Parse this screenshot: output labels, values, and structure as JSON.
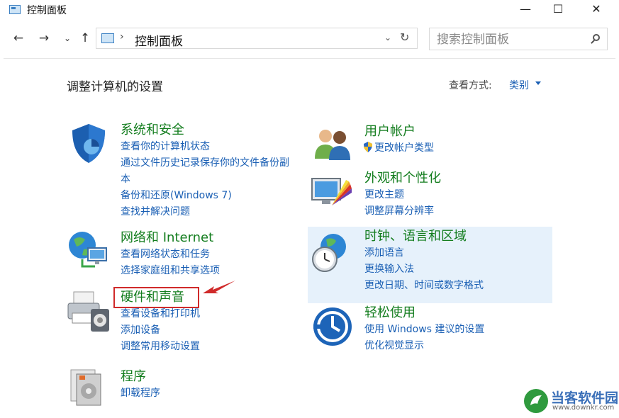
{
  "window": {
    "title": "控制面板",
    "minimize": "—",
    "maximize": "☐",
    "close": "✕"
  },
  "nav": {
    "back": "←",
    "forward": "→",
    "recent": "⌄",
    "up": "↑"
  },
  "address": {
    "separator": "›",
    "path": "控制面板",
    "dropdown": "⌄",
    "refresh": "↻"
  },
  "search": {
    "placeholder": "搜索控制面板"
  },
  "main": {
    "heading": "调整计算机的设置",
    "view_label": "查看方式:",
    "view_value": "类别"
  },
  "categories": {
    "system": {
      "title": "系统和安全",
      "links": [
        "查看你的计算机状态",
        "通过文件历史记录保存你的文件备份副",
        "本",
        "备份和还原(Windows 7)",
        "查找并解决问题"
      ]
    },
    "network": {
      "title": "网络和 Internet",
      "links": [
        "查看网络状态和任务",
        "选择家庭组和共享选项"
      ]
    },
    "hardware": {
      "title": "硬件和声音",
      "links": [
        "查看设备和打印机",
        "添加设备",
        "调整常用移动设置"
      ]
    },
    "programs": {
      "title": "程序",
      "links": [
        "卸载程序"
      ]
    },
    "users": {
      "title": "用户帐户",
      "links": [
        "更改帐户类型"
      ]
    },
    "appearance": {
      "title": "外观和个性化",
      "links": [
        "更改主题",
        "调整屏幕分辨率"
      ]
    },
    "clock": {
      "title": "时钟、语言和区域",
      "links": [
        "添加语言",
        "更换输入法",
        "更改日期、时间或数字格式"
      ]
    },
    "ease": {
      "title": "轻松使用",
      "links": [
        "使用 Windows 建议的设置",
        "优化视觉显示"
      ]
    }
  },
  "watermark": {
    "name": "当客软件园",
    "url": "www.downkr.com"
  },
  "colors": {
    "category_title": "#137d1e",
    "link": "#1a5fb4",
    "highlight": "#e6f1fb",
    "annotation": "#d02a2a"
  }
}
